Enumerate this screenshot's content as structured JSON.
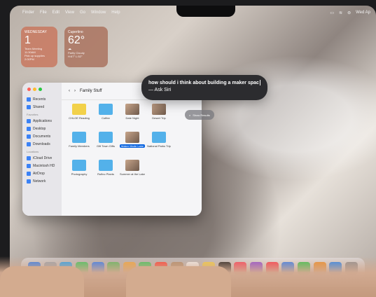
{
  "menubar": {
    "items": [
      "Finder",
      "File",
      "Edit",
      "View",
      "Go",
      "Window",
      "Help"
    ],
    "clock": "Wed Ap"
  },
  "widgets": {
    "calendar": {
      "day": "WEDNESDAY",
      "date": "1",
      "event1": "Team Meeting",
      "event1_time": "11:30AM",
      "event2": "Pick up supplies",
      "event2_time": "2:00PM"
    },
    "weather": {
      "city": "Cupertino",
      "temp": "62°",
      "condition": "Partly Cloudy",
      "range": "H:67° L:52°"
    }
  },
  "finder": {
    "title": "Family Stuff",
    "sidebar": {
      "favorites": [
        {
          "label": "Recents",
          "icon": "clock-icon"
        },
        {
          "label": "Shared",
          "icon": "folder-shared-icon"
        }
      ],
      "favorites_heading": "Favorites",
      "favorites2": [
        {
          "label": "Applications",
          "icon": "applications-icon"
        },
        {
          "label": "Desktop",
          "icon": "desktop-icon"
        },
        {
          "label": "Documents",
          "icon": "documents-icon"
        },
        {
          "label": "Downloads",
          "icon": "downloads-icon"
        }
      ],
      "locations_heading": "Locations",
      "locations": [
        {
          "label": "iCloud Drive",
          "icon": "icloud-icon"
        },
        {
          "label": "Macintosh HD",
          "icon": "disk-icon"
        },
        {
          "label": "AirDrop",
          "icon": "airdrop-icon"
        },
        {
          "label": "Network",
          "icon": "network-icon"
        }
      ]
    },
    "items": [
      {
        "label": "CHLOE Reading",
        "kind": "folder yellow"
      },
      {
        "label": "Coffee",
        "kind": "folder"
      },
      {
        "label": "Date Night",
        "kind": "photo"
      },
      {
        "label": "Desert Trip",
        "kind": "photo"
      },
      {
        "label": "",
        "kind": "none"
      },
      {
        "label": "Family Members",
        "kind": "folder"
      },
      {
        "label": "Gift Town Gifts",
        "kind": "folder"
      },
      {
        "label": "Maker Mode Lake",
        "kind": "photo",
        "selected": true
      },
      {
        "label": "National Parks Trip",
        "kind": "folder"
      },
      {
        "label": "",
        "kind": "none"
      },
      {
        "label": "Photography",
        "kind": "folder"
      },
      {
        "label": "Rufino Plants",
        "kind": "folder"
      },
      {
        "label": "Summer at the Lake",
        "kind": "photo"
      },
      {
        "label": "",
        "kind": "none"
      },
      {
        "label": "",
        "kind": "none"
      }
    ]
  },
  "siri": {
    "query": "how should i think about building a maker spac",
    "prompt": "— Ask Siri",
    "show_results": "Show Results"
  },
  "dock": {
    "apps": [
      "finder-icon",
      "launchpad-icon",
      "safari-icon",
      "messages-icon",
      "mail-icon",
      "maps-icon",
      "photos-icon",
      "facetime-icon",
      "calendar-icon",
      "contacts-icon",
      "reminders-icon",
      "notes-icon",
      "tv-icon",
      "music-icon",
      "podcasts-icon",
      "news-icon",
      "keynote-icon",
      "numbers-icon",
      "pages-icon",
      "appstore-icon",
      "settings-icon"
    ],
    "colors": [
      "#2b7bf0",
      "#9aa2ad",
      "#1fa1f4",
      "#37c759",
      "#2a78f7",
      "#58b95c",
      "#f2a73a",
      "#38c759",
      "#ff3b30",
      "#b08b69",
      "#f7f7f7",
      "#f5d142",
      "#141414",
      "#fc3c57",
      "#8e45d8",
      "#ff3347",
      "#2d7cf6",
      "#2ec64a",
      "#f08d24",
      "#1a82f7",
      "#8c8c90"
    ]
  }
}
